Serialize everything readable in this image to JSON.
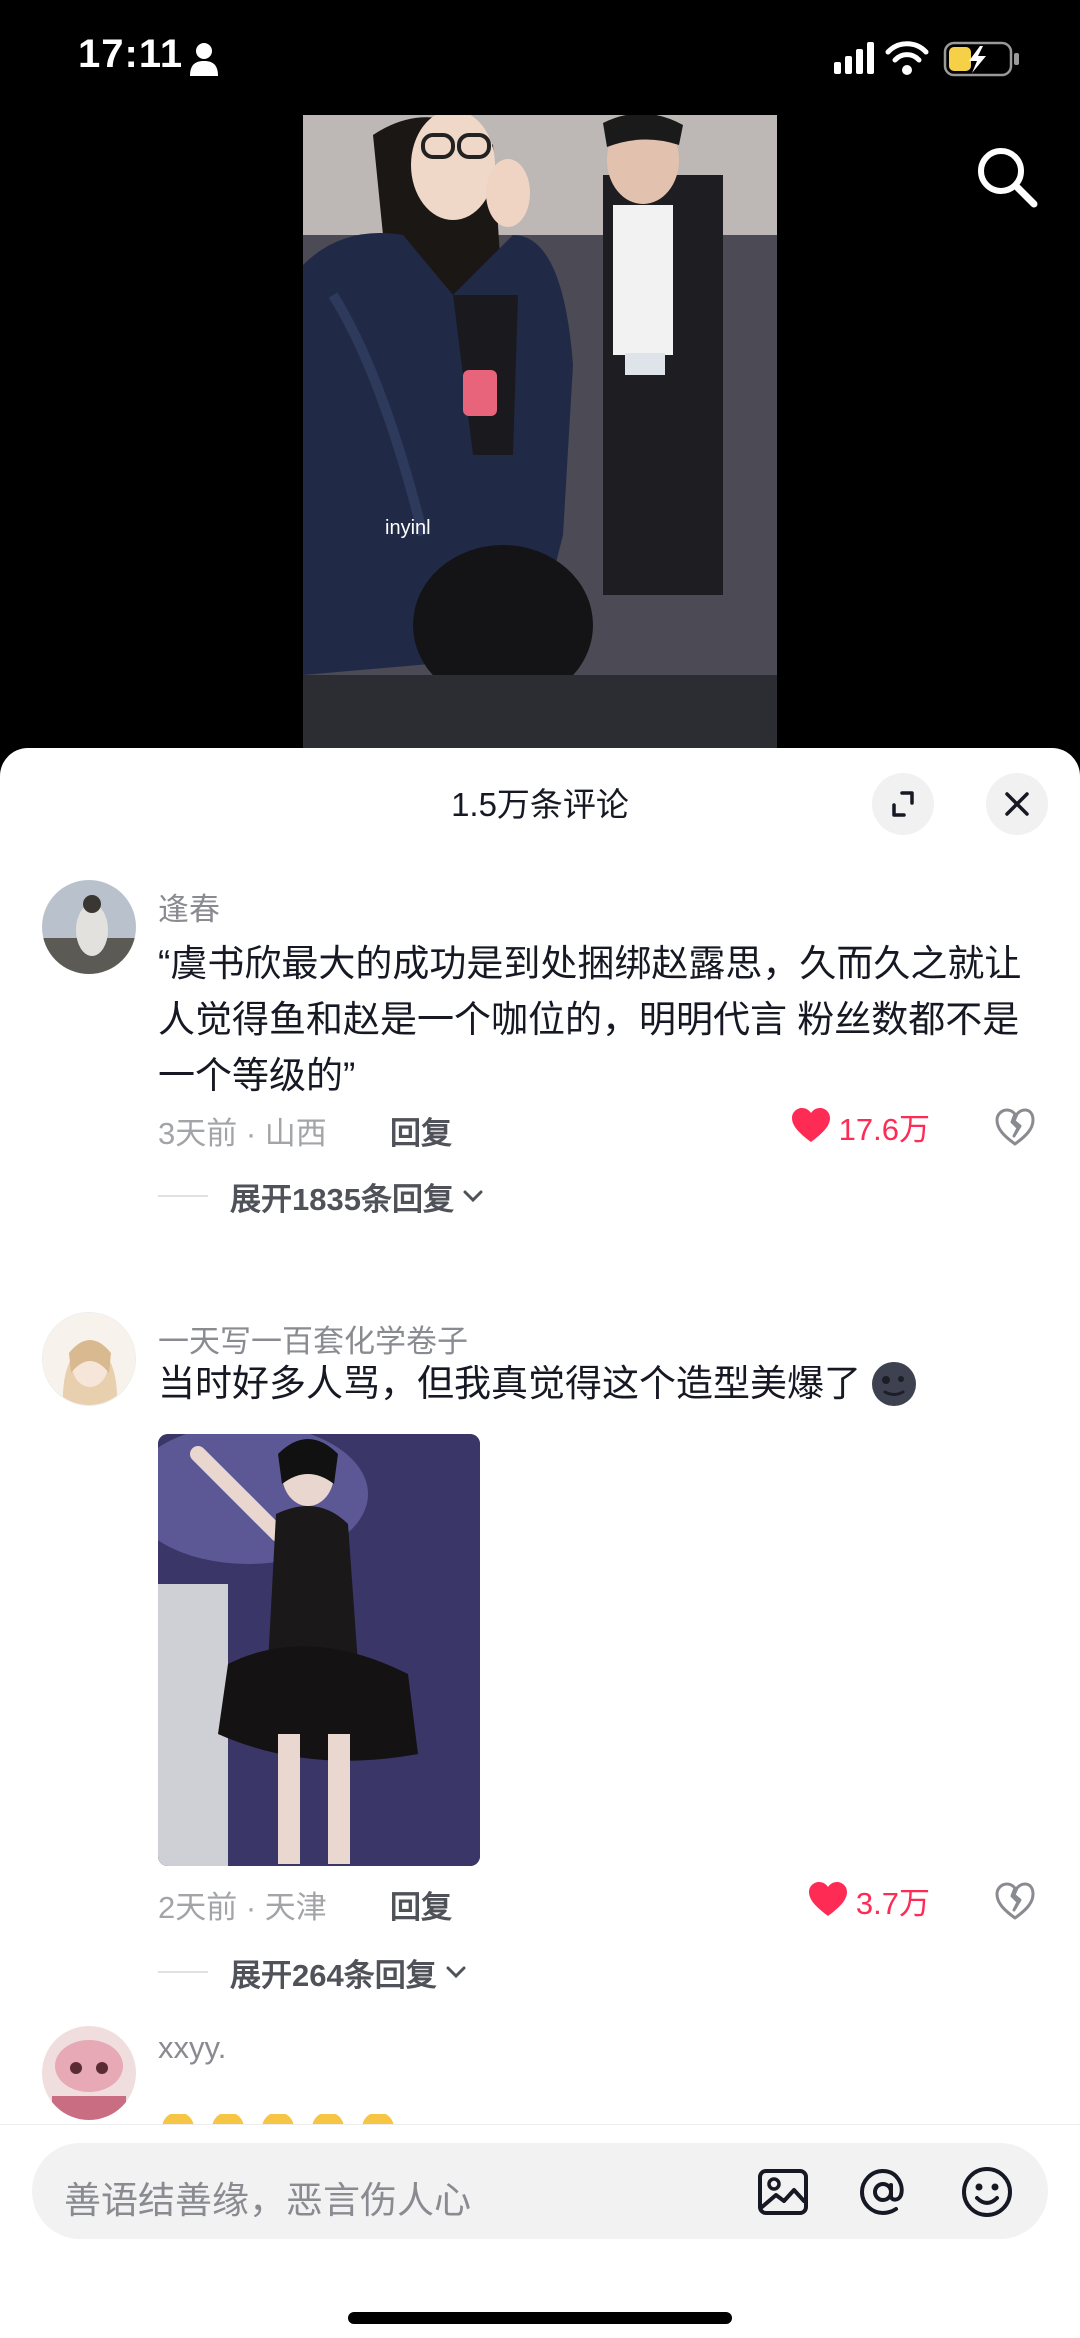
{
  "status_bar": {
    "time": "17:11"
  },
  "video": {
    "watermark": "inyinl"
  },
  "comments_sheet": {
    "title": "1.5万条评论",
    "comments": [
      {
        "username": "逢春",
        "text": "“虞书欣最大的成功是到处捆绑赵露思，久而久之就让人觉得鱼和赵是一个咖位的，明明代言 粉丝数都不是一个等级的”",
        "meta": "3天前 · 山西",
        "reply_label": "回复",
        "likes": "17.6万",
        "expand_label": "展开1835条回复"
      },
      {
        "username": "一天写一百套化学卷子",
        "text": "当时好多人骂，但我真觉得这个造型美爆了",
        "meta": "2天前 · 天津",
        "reply_label": "回复",
        "likes": "3.7万",
        "expand_label": "展开264条回复"
      },
      {
        "username": "xxyy."
      }
    ]
  },
  "input_bar": {
    "placeholder": "善语结善缘，恶言伤人心"
  },
  "colors": {
    "accent": "#fe2c55",
    "text_primary": "#161823",
    "text_secondary": "#8a8b91"
  }
}
